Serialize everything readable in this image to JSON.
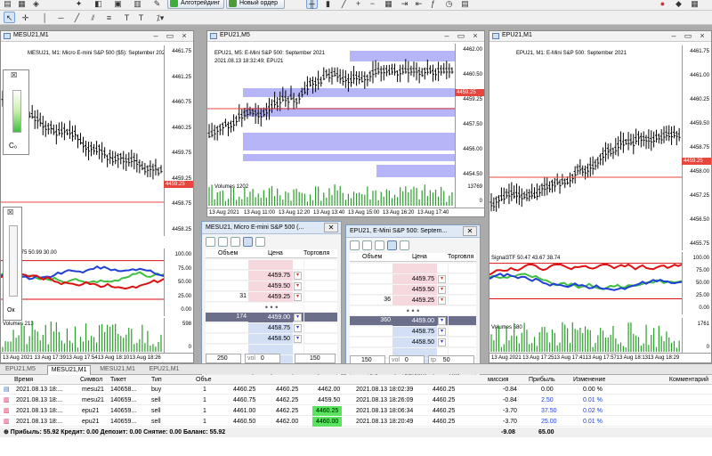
{
  "toolbar": {
    "algo_label": "Алготрейдинг",
    "new_order_label": "Новый ордер"
  },
  "colors": {
    "price_line": "#e8453c",
    "green": "#3fbf3f",
    "blue": "#1f3fd6",
    "pink": "#f6d8df",
    "lightblue": "#d3dff5"
  },
  "win1": {
    "title": "MESU21,M1",
    "header": "MESU21, M1:  Micro E-mini S&P 500 ($5): September 202",
    "y_labels": [
      "4461.75",
      "4461.25",
      "4460.75",
      "4460.25",
      "4459.75",
      "4459.25",
      "4458.75",
      "4458.25"
    ],
    "price_tag": "4459.25",
    "ind_header": "3TF 52.75 50.99 30.00",
    "ind_labels": [
      "100.00",
      "75.00",
      "50.00",
      "25.00",
      "0.00"
    ],
    "vol_header": "Volumes 213",
    "vol_labels": [
      "598",
      "0"
    ],
    "x_labels": [
      "13 Aug 2021",
      "13 Aug 17:39",
      "13 Aug 17:54",
      "13 Aug 18:10",
      "13 Aug 18:26"
    ]
  },
  "win2": {
    "title": "EPU21,M5",
    "header": "EPU21, M5:  E-Mini S&P 500: September 2021",
    "subheader": "2021.08.13 18:32:49; EPU21",
    "y_labels": [
      "4462.00",
      "4460.50",
      "4459.25",
      "4457.50",
      "4456.00",
      "4454.50"
    ],
    "price_tag": "4459.25",
    "vol_header": "Volumes 1202",
    "vol_labels": [
      "13769",
      "0"
    ],
    "x_labels": [
      "13 Aug 2021",
      "13 Aug 11:00",
      "13 Aug 12:20",
      "13 Aug 13:40",
      "13 Aug 15:00",
      "13 Aug 16:20",
      "13 Aug 17:40"
    ]
  },
  "win3": {
    "title": "EPU21,M1",
    "header": "EPU21, M1:  E-Mini S&P 500: September 2021",
    "y_labels": [
      "4461.75",
      "4461.00",
      "4460.25",
      "4459.50",
      "4458.75",
      "4458.00",
      "4457.25",
      "4456.50",
      "4455.75"
    ],
    "price_tag": "4459.25",
    "ind_header": "Signal3TF 50.47 43.67 38.74",
    "ind_labels": [
      "100.00",
      "75.00",
      "50.00",
      "25.00",
      "0.00"
    ],
    "vol_header": "Volumes 580",
    "vol_labels": [
      "1761",
      "0"
    ],
    "x_labels": [
      "13 Aug 2021",
      "13 Aug 17:25",
      "13 Aug 17:41",
      "13 Aug 17:57",
      "13 Aug 18:13",
      "13 Aug 18:29"
    ]
  },
  "dom1": {
    "title": "MESU21, Micro E-mini S&P 500 (...",
    "headers": [
      "Объем",
      "Цена",
      "Торговля"
    ],
    "sell_rows": [
      {
        "vol": "",
        "price": "4459.75"
      },
      {
        "vol": "",
        "price": "4459.50"
      },
      {
        "vol": "31",
        "price": "4459.25"
      }
    ],
    "buy_rows": [
      {
        "vol": "174",
        "price": "4459.00"
      },
      {
        "vol": "",
        "price": "4458.75"
      },
      {
        "vol": "",
        "price": "4458.50"
      }
    ],
    "dots": "• • •",
    "qty_left": "250",
    "vol_label": "vol",
    "vol_value": "0",
    "qty_right": "150",
    "sell": "Sell",
    "close": "Закрыть",
    "buy": "Buy"
  },
  "dom2": {
    "title": "EPU21, E-Mini S&P 500: Septem...",
    "headers": [
      "Объем",
      "Цена",
      "Торговля"
    ],
    "sell_rows": [
      {
        "vol": "",
        "price": "4459.75"
      },
      {
        "vol": "",
        "price": "4459.50"
      },
      {
        "vol": "36",
        "price": "4459.25"
      }
    ],
    "buy_rows": [
      {
        "vol": "360",
        "price": "4459.00"
      },
      {
        "vol": "",
        "price": "4458.75"
      },
      {
        "vol": "",
        "price": "4458.50"
      }
    ],
    "dots": "• • •",
    "qty_left": "150",
    "vol_label": "vol",
    "vol_value": "0",
    "tp_label": "tp",
    "qty_right": "50",
    "sell": "Sell",
    "close": "Закрыть",
    "buy": "Buy"
  },
  "chart_tabs": [
    "EPU21,M5",
    "MESU21,M1",
    "MESU21,M1",
    "EPU21,M1"
  ],
  "grid": {
    "headers": {
      "time": "Время",
      "symbol": "Символ",
      "ticket": "Тикет",
      "type": "Тип",
      "volume": "Объе",
      "commission": "миссия",
      "profit": "Прибыль",
      "change": "Изменение",
      "comment": "Комментарий"
    },
    "rows": [
      {
        "time": "2021.08.13 18:...",
        "symbol": "mesu21",
        "ticket": "140658...",
        "type": "buy",
        "vol": "1",
        "open": "4460.25",
        "sl": "4460.25",
        "tp": "4462.00",
        "closetime": "2021.08.13 18:02:39",
        "price": "4460.25",
        "comm": "-0.84",
        "profit": "0.00",
        "change": "0.00 %"
      },
      {
        "time": "2021.08.13 18:...",
        "symbol": "mesu21",
        "ticket": "140659...",
        "type": "sell",
        "vol": "1",
        "open": "4460.75",
        "sl": "4462.25",
        "tp": "4459.50",
        "closetime": "2021.08.13 18:26:09",
        "price": "4460.25",
        "comm": "-0.84",
        "profit": "2.50",
        "change": "0.01 %"
      },
      {
        "time": "2021.08.13 18:...",
        "symbol": "epu21",
        "ticket": "140659...",
        "type": "sell",
        "vol": "1",
        "open": "4461.00",
        "sl": "4462.25",
        "tp": "4460.25",
        "closetime": "2021.08.13 18:06:34",
        "price": "4460.25",
        "comm": "-3.70",
        "profit": "37.50",
        "change": "0.02 %"
      },
      {
        "time": "2021.08.13 18:...",
        "symbol": "epu21",
        "ticket": "140659...",
        "type": "sell",
        "vol": "1",
        "open": "4460.50",
        "sl": "4462.00",
        "tp": "4460.00",
        "closetime": "2021.08.13 18:20:49",
        "price": "4460.25",
        "comm": "-3.70",
        "profit": "25.00",
        "change": "0.01 %"
      }
    ],
    "summary": "Прибыль: 55.92  Кредит: 0.00  Депозит: 0.00  Снятие: 0.00  Баланс: 55.92",
    "sum_comm": "-9.08",
    "sum_profit": "65.00"
  },
  "side_panel": {
    "label": "C₀",
    "label2": "Ок"
  }
}
